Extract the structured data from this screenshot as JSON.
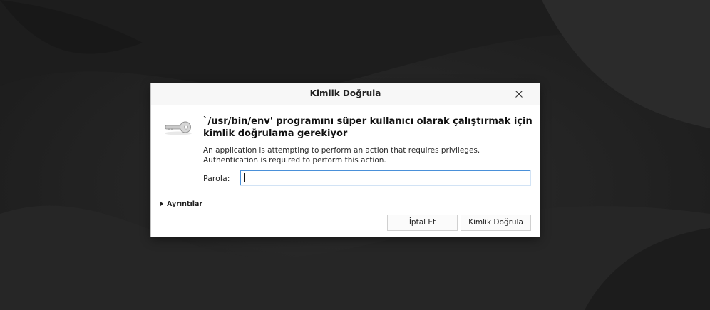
{
  "dialog": {
    "title": "Kimlik Doğrula",
    "heading": "`/usr/bin/env' programını süper kullanıcı olarak çalıştırmak için kimlik doğrulama gerekiyor",
    "description_line1": "An application is attempting to perform an action that requires privileges.",
    "description_line2": "Authentication is required to perform this action.",
    "password_label": "Parola:",
    "password_value": "",
    "details_label": "Ayrıntılar",
    "cancel_label": "İptal Et",
    "authenticate_label": "Kimlik Doğrula",
    "icons": {
      "close": "close-icon",
      "key": "key-icon",
      "expander": "triangle-right-icon"
    }
  },
  "colors": {
    "focus_border": "#4a90d9",
    "background": "#202020"
  }
}
